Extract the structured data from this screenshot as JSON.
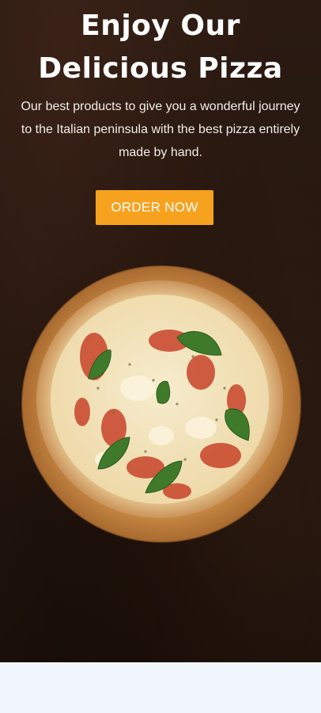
{
  "hero": {
    "title_line1": "Enjoy Our",
    "title_line2": "Delicious Pizza",
    "subtitle": "Our best products to give you a wonderful journey to the Italian peninsula with the best pizza entirely made by hand.",
    "button_label": "ORDER NOW",
    "image_icon": "pizza-on-wooden-board"
  },
  "colors": {
    "background": "#24160f",
    "accent": "#f7a21f",
    "footer": "#f1f6fc"
  }
}
